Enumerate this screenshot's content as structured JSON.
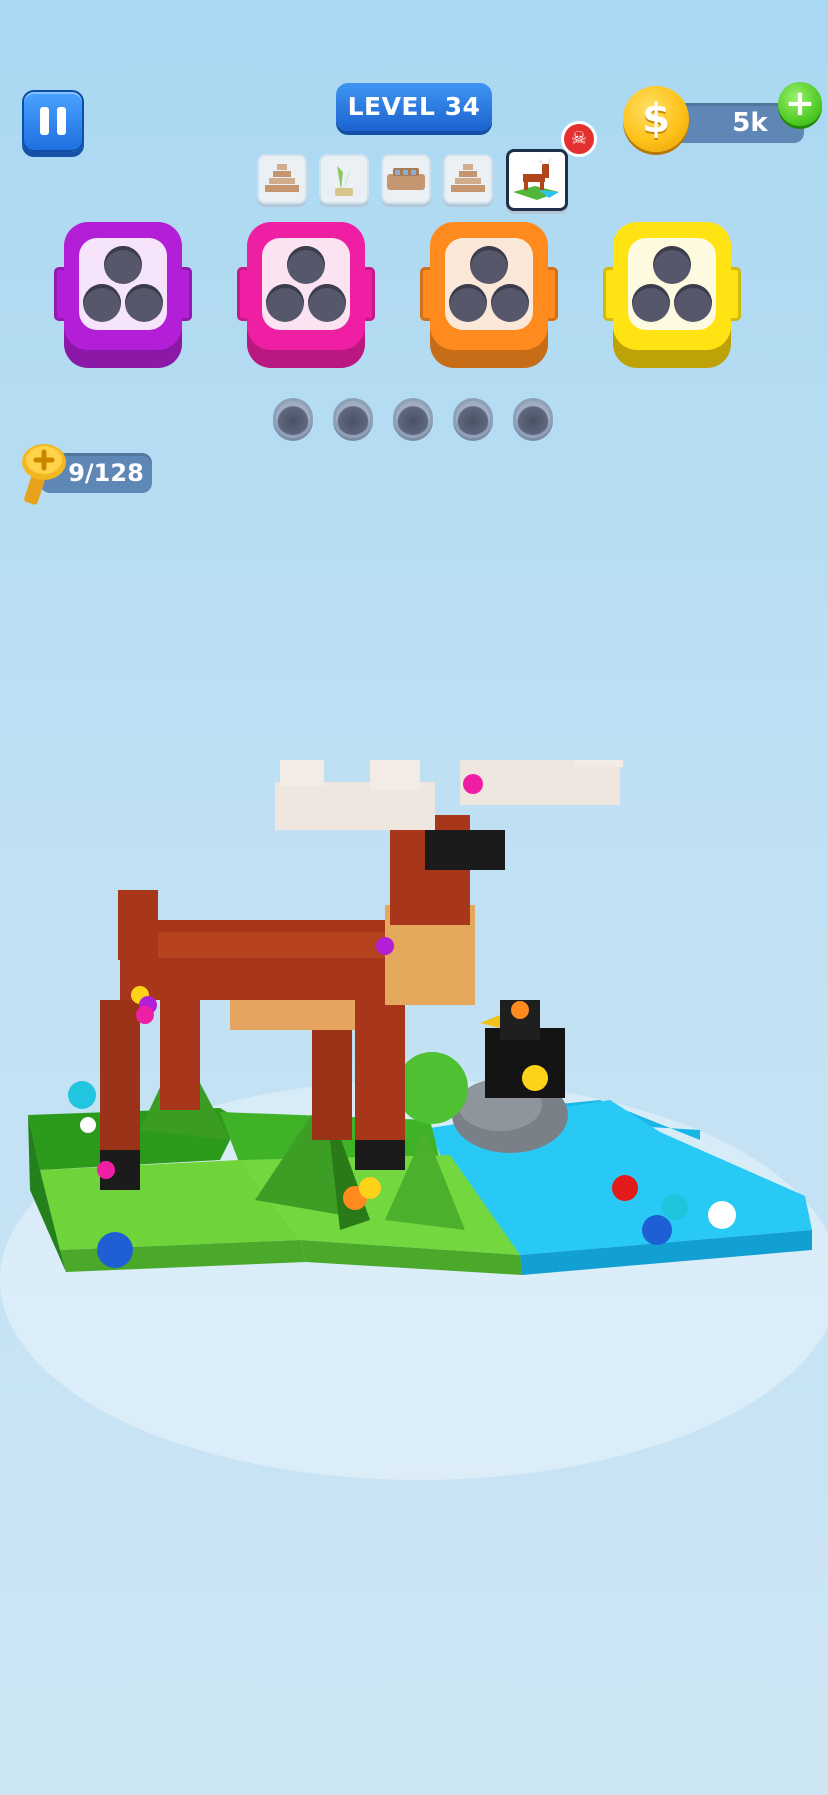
{
  "header": {
    "level_label": "LEVEL 34",
    "coins_value": "5k",
    "coin_symbol": "$",
    "add_coins_symbol": "+"
  },
  "level_thumbnails": [
    {
      "name": "pyramid-thumbnail",
      "active": false
    },
    {
      "name": "plant-thumbnail",
      "active": false
    },
    {
      "name": "toolbox-thumbnail",
      "active": false
    },
    {
      "name": "pyramid-thumbnail-2",
      "active": false
    },
    {
      "name": "deer-scene-thumbnail",
      "active": true
    }
  ],
  "skull_badge_symbol": "☠",
  "buckets": [
    {
      "color": "#b21fd6",
      "face": "#f6e4fb"
    },
    {
      "color": "#ef1fa4",
      "face": "#fbe3f2"
    },
    {
      "color": "#ff8a1d",
      "face": "#fbe8d8"
    },
    {
      "color": "#ffe313",
      "face": "#fdfae0"
    }
  ],
  "empty_slots": 5,
  "screw_counter": "9/128"
}
